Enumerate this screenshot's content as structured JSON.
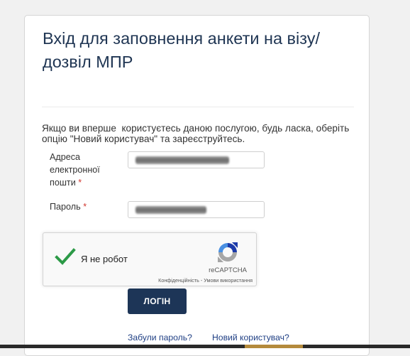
{
  "page": {
    "title": "Вхід для заповнення анкети на візу/ дозвіл МПР",
    "intro_text": "Якщо ви вперше  користуєтесь даною послугою, будь ласка, оберіть опцію \"Новий користувач\" та зареєструйтесь."
  },
  "form": {
    "email": {
      "label": "Адреса електронної пошти",
      "required_mark": "*",
      "value_redacted": true
    },
    "password": {
      "label": "Пароль",
      "required_mark": "*",
      "value_redacted": true
    }
  },
  "recaptcha": {
    "label": "Я не робот",
    "brand": "reCAPTCHA",
    "privacy_link": "Конфіденційність",
    "separator": " - ",
    "terms_link": "Умови використання"
  },
  "actions": {
    "login_button": "Логін",
    "forgot_password_link": "Забули пароль?",
    "new_user_link": "Новий користувач?"
  },
  "colors": {
    "page_background": "#f1f1f1",
    "title_text": "#1f3553",
    "primary_button": "#1d3557",
    "link_text": "#1f3f84",
    "required_mark": "#d0342c",
    "recaptcha_check": "#2c9a47"
  }
}
